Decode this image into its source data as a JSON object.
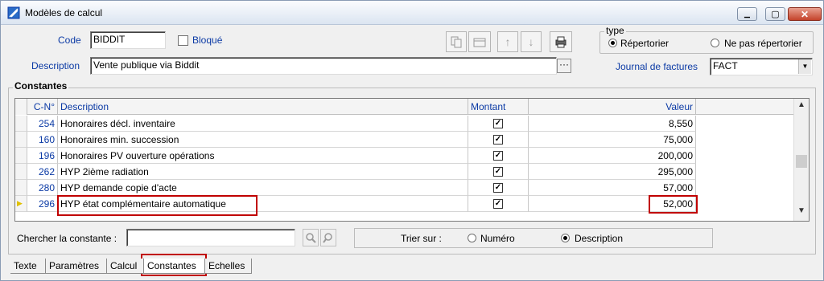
{
  "window": {
    "title": "Modèles de calcul",
    "controls": {
      "minimize": "▁",
      "maximize": "▢",
      "close": "✕"
    }
  },
  "form": {
    "code_label": "Code",
    "code_value": "BIDDIT",
    "bloque_label": "Bloqué",
    "bloque_checked": false,
    "description_label": "Description",
    "description_value": "Vente publique via Biddit",
    "description_button": "···",
    "journal_label": "Journal de factures",
    "journal_value": "FACT",
    "dropdown_arrow": "▼"
  },
  "type_group": {
    "legend": "type",
    "options": [
      {
        "label": "Répertorier",
        "selected": true
      },
      {
        "label": "Ne pas répertorier",
        "selected": false
      }
    ]
  },
  "toolbar": {
    "icons": [
      "copy-icon",
      "paste-icon",
      "arrow-up-icon",
      "arrow-down-icon",
      "printer-icon"
    ],
    "up_glyph": "↑",
    "down_glyph": "↓",
    "printer_glyph": "🖨"
  },
  "constantes": {
    "legend": "Constantes",
    "columns": [
      "C-N°",
      "Description",
      "Montant",
      "Valeur"
    ],
    "rows": [
      {
        "cn": "254",
        "description": "Honoraires décl. inventaire",
        "montant": true,
        "valeur": "8,550"
      },
      {
        "cn": "160",
        "description": "Honoraires min. succession",
        "montant": true,
        "valeur": "75,000"
      },
      {
        "cn": "196",
        "description": "Honoraires PV ouverture opérations",
        "montant": true,
        "valeur": "200,000"
      },
      {
        "cn": "262",
        "description": "HYP 2ième radiation",
        "montant": true,
        "valeur": "295,000"
      },
      {
        "cn": "280",
        "description": "HYP demande copie d'acte",
        "montant": true,
        "valeur": "57,000"
      },
      {
        "cn": "296",
        "description": "HYP état complémentaire automatique",
        "montant": true,
        "valeur": "52,000",
        "current": true
      }
    ],
    "check_glyph": "✓",
    "row_indicator": "▶",
    "scroll_up": "▲",
    "scroll_down": "▼"
  },
  "search": {
    "label": "Chercher la constante :",
    "value": ""
  },
  "sort": {
    "label": "Trier sur :",
    "options": [
      {
        "label": "Numéro",
        "selected": false
      },
      {
        "label": "Description",
        "selected": true
      }
    ]
  },
  "tabs": [
    {
      "label": "Texte",
      "active": false
    },
    {
      "label": "Paramètres",
      "active": false
    },
    {
      "label": "Calcul",
      "active": false
    },
    {
      "label": "Constantes",
      "active": true
    },
    {
      "label": "Echelles",
      "active": false
    }
  ],
  "colors": {
    "label_blue": "#0b3aa5",
    "highlight_red": "#c00000"
  }
}
